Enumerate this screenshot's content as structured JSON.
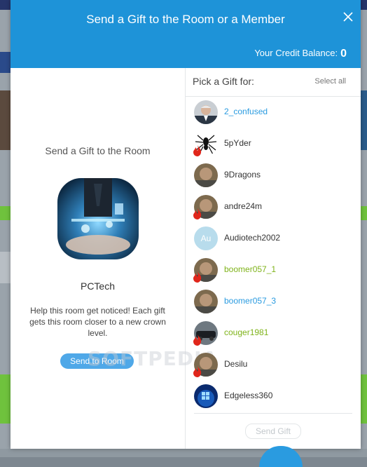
{
  "modal": {
    "title": "Send a Gift to the Room or a Member",
    "credit_label": "Your Credit Balance:",
    "credit_value": "0"
  },
  "room": {
    "heading": "Send a Gift to the Room",
    "name": "PCTech",
    "description": "Help this room get noticed! Each gift gets this room closer to a new crown level.",
    "send_button": "Send to Room",
    "watermark": "SOFTPEDIA"
  },
  "picker": {
    "label": "Pick a Gift for:",
    "select_all": "Select all",
    "send_button": "Send Gift",
    "members": [
      {
        "name": "2_confused",
        "color": "blue",
        "flame": false,
        "avatar": "person"
      },
      {
        "name": "5pYder",
        "color": "dark",
        "flame": true,
        "avatar": "spider"
      },
      {
        "name": "9Dragons",
        "color": "dark",
        "flame": false,
        "avatar": "photo"
      },
      {
        "name": "andre24m",
        "color": "dark",
        "flame": true,
        "avatar": "photo"
      },
      {
        "name": "Audiotech2002",
        "color": "dark",
        "flame": false,
        "avatar": "initials",
        "initials": "Au"
      },
      {
        "name": "boomer057_1",
        "color": "green",
        "flame": true,
        "avatar": "photo"
      },
      {
        "name": "boomer057_3",
        "color": "blue",
        "flame": false,
        "avatar": "photo"
      },
      {
        "name": "couger1981",
        "color": "green",
        "flame": true,
        "avatar": "car"
      },
      {
        "name": "Desilu",
        "color": "dark",
        "flame": true,
        "avatar": "photo"
      },
      {
        "name": "Edgeless360",
        "color": "dark",
        "flame": false,
        "avatar": "windows"
      }
    ]
  },
  "colors": {
    "header": "#1e93d8",
    "link_blue": "#2a9be0",
    "online_green": "#7fb31a",
    "flame_red": "#e0261b"
  }
}
